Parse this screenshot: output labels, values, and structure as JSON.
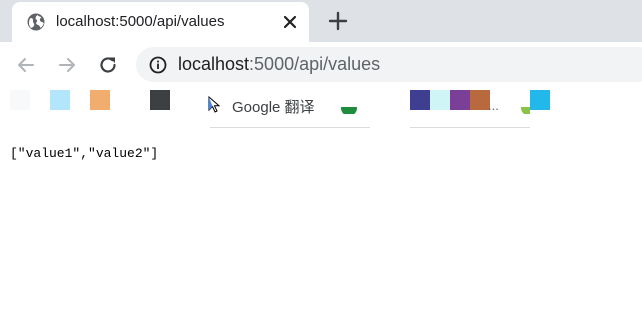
{
  "tab": {
    "title": "localhost:5000/api/values",
    "favicon_icon": "globe-icon",
    "close_icon": "close-icon"
  },
  "new_tab_icon": "plus-icon",
  "toolbar": {
    "back_icon": "arrow-left-icon",
    "forward_icon": "arrow-right-icon",
    "reload_icon": "reload-icon",
    "info_icon": "info-icon"
  },
  "omnibox": {
    "host": "localhost",
    "rest": ":5000/api/values"
  },
  "bookmarks": {
    "google_translate_label": "Google 翻译",
    "overflow": "...",
    "colors": [
      "#f8f9fa",
      "#b3e5fc",
      "#f0ad6e",
      "#3c4043",
      "#3f3f91",
      "#cff5f7",
      "#7b3f98",
      "#b8693d",
      "#23b8ea"
    ]
  },
  "page": {
    "body_text": "[\"value1\",\"value2\"]"
  },
  "colors": {
    "tabstrip": "#dee1e6",
    "omnibox": "#f1f3f4"
  }
}
